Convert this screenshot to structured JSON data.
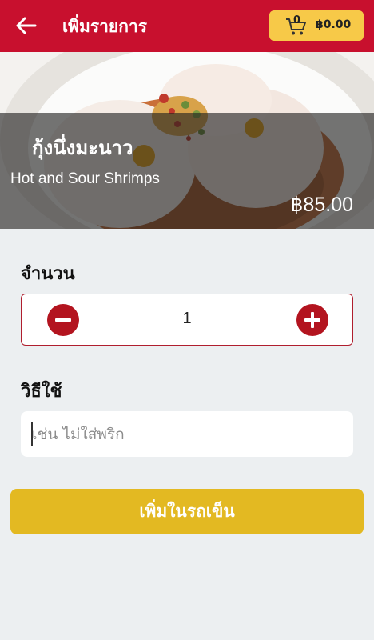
{
  "header": {
    "title": "เพิ่มรายการ",
    "back_icon": "arrow-left-icon",
    "cart": {
      "count": "0",
      "total": "฿0.00",
      "icon": "shopping-cart-icon"
    }
  },
  "dish": {
    "name_th": "กุ้งนึ่งมะนาว",
    "name_en": "Hot and Sour Shrimps",
    "price": "฿85.00"
  },
  "quantity": {
    "label": "จำนวน",
    "value": "1",
    "minus_icon": "minus-circle-icon",
    "plus_icon": "plus-circle-icon"
  },
  "note": {
    "label": "วิธีใช้",
    "placeholder": "เช่น ไม่ใส่พริก",
    "value": ""
  },
  "action": {
    "add_to_cart_label": "เพิ่มในรถเข็น"
  },
  "colors": {
    "primary": "#c8102e",
    "accent_yellow": "#e3b922",
    "cart_yellow": "#f7c948",
    "background": "#eceff1"
  }
}
